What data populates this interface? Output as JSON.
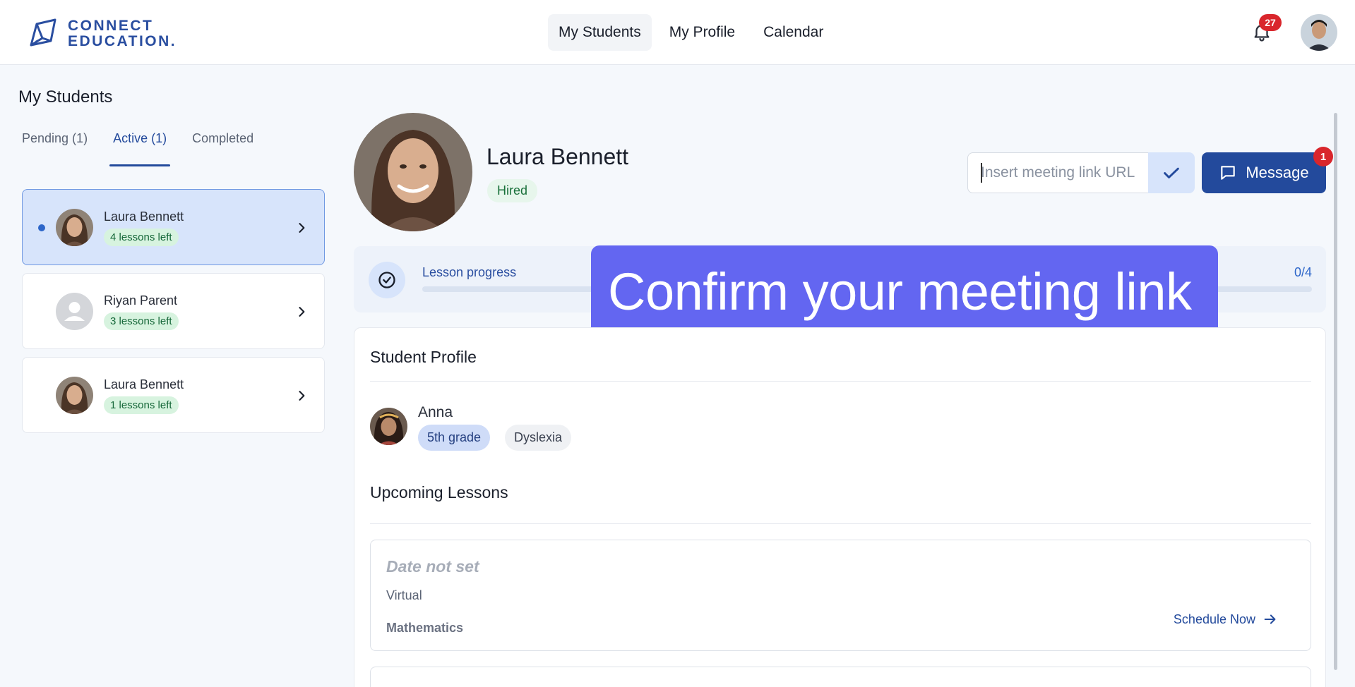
{
  "header": {
    "logo_line1": "CONNECT",
    "logo_line2": "EDUCATION.",
    "nav": [
      {
        "label": "My Students",
        "active": true
      },
      {
        "label": "My Profile",
        "active": false
      },
      {
        "label": "Calendar",
        "active": false
      }
    ],
    "notification_count": "27"
  },
  "sidebar": {
    "title": "My Students",
    "tabs": [
      {
        "label": "Pending (1)",
        "active": false
      },
      {
        "label": "Active (1)",
        "active": true
      },
      {
        "label": "Completed",
        "active": false
      }
    ],
    "students": [
      {
        "name": "Laura Bennett",
        "lessons": "4 lessons left",
        "selected": true,
        "avatar": "photo"
      },
      {
        "name": "Riyan Parent",
        "lessons": "3 lessons left",
        "selected": false,
        "avatar": "placeholder"
      },
      {
        "name": "Laura Bennett",
        "lessons": "1 lessons left",
        "selected": false,
        "avatar": "photo"
      }
    ]
  },
  "main": {
    "name": "Laura Bennett",
    "status": "Hired",
    "meeting_placeholder": "Insert meeting link URL",
    "message_label": "Message",
    "message_badge": "1",
    "progress": {
      "label": "Lesson progress",
      "count": "0/4",
      "fraction": 0
    },
    "overlay_text": "Confirm your meeting link",
    "profile": {
      "title": "Student Profile",
      "student_name": "Anna",
      "grade": "5th grade",
      "condition": "Dyslexia"
    },
    "upcoming": {
      "title": "Upcoming Lessons",
      "lessons": [
        {
          "date": "Date not set",
          "mode": "Virtual",
          "subject": "Mathematics",
          "action": "Schedule Now"
        }
      ]
    }
  },
  "colors": {
    "brand": "#234a9c",
    "accent": "#2d66c9",
    "overlay": "#6366f1",
    "badge_red": "#d9262c"
  }
}
